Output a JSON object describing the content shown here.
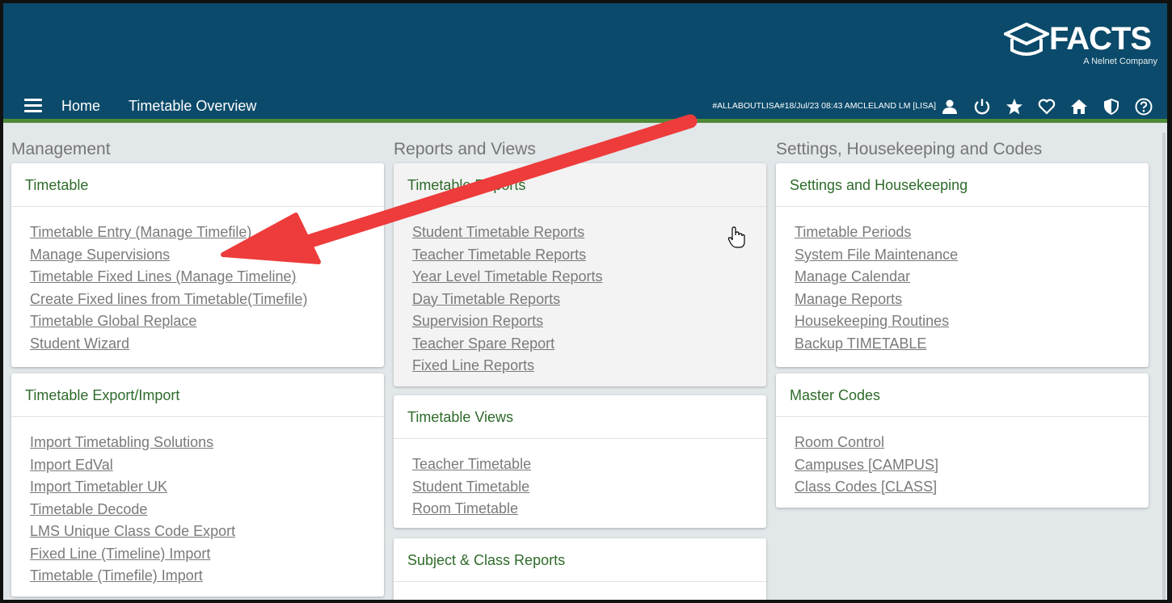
{
  "header": {
    "logo_text": "FACTS",
    "logo_tagline": "A Nelnet Company",
    "nav_links": [
      "Home",
      "Timetable Overview"
    ],
    "session_info": "#ALLABOUTLISA#18/Jul/23 08:43 AMCLELAND LM [LISA]",
    "icons": [
      "user-icon",
      "power-icon",
      "star-icon",
      "heart-icon",
      "home-icon",
      "shield-icon",
      "help-icon"
    ],
    "bar_color": "#0b4a6a",
    "accent_color": "#4f8a3a"
  },
  "columns": [
    {
      "title": "Management",
      "cards": [
        {
          "title": "Timetable",
          "links": [
            "Timetable Entry (Manage Timefile)",
            "Manage Supervisions",
            "Timetable Fixed Lines (Manage Timeline)",
            "Create Fixed lines from Timetable(Timefile)",
            "Timetable Global Replace",
            "Student Wizard"
          ]
        },
        {
          "title": "Timetable Export/Import",
          "links": [
            "Import Timetabling Solutions",
            "Import EdVal",
            "Import Timetabler UK",
            "Timetable Decode",
            "LMS Unique Class Code Export",
            "Fixed Line (Timeline) Import",
            "Timetable (Timefile) Import"
          ]
        }
      ]
    },
    {
      "title": "Reports and Views",
      "cards": [
        {
          "title": "Timetable Reports",
          "links": [
            "Student Timetable Reports",
            "Teacher Timetable Reports",
            "Year Level Timetable Reports",
            "Day Timetable Reports",
            "Supervision Reports",
            "Teacher Spare Report",
            "Fixed Line Reports"
          ]
        },
        {
          "title": "Timetable Views",
          "links": [
            "Teacher Timetable",
            "Student Timetable",
            "Room Timetable"
          ]
        },
        {
          "title": "Subject & Class Reports",
          "links": []
        }
      ]
    },
    {
      "title": "Settings, Housekeeping and Codes",
      "cards": [
        {
          "title": "Settings and Housekeeping",
          "links": [
            "Timetable Periods",
            "System File Maintenance",
            "Manage Calendar",
            "Manage Reports",
            "Housekeeping Routines",
            "Backup TIMETABLE"
          ]
        },
        {
          "title": "Master Codes",
          "links": [
            "Room Control",
            "Campuses [CAMPUS]",
            "Class Codes [CLASS]"
          ]
        }
      ]
    }
  ],
  "annotation": {
    "highlighted_item": "Manage Supervisions",
    "highlight_color": "#eaf75a",
    "arrow_color": "#ee3b3b"
  }
}
